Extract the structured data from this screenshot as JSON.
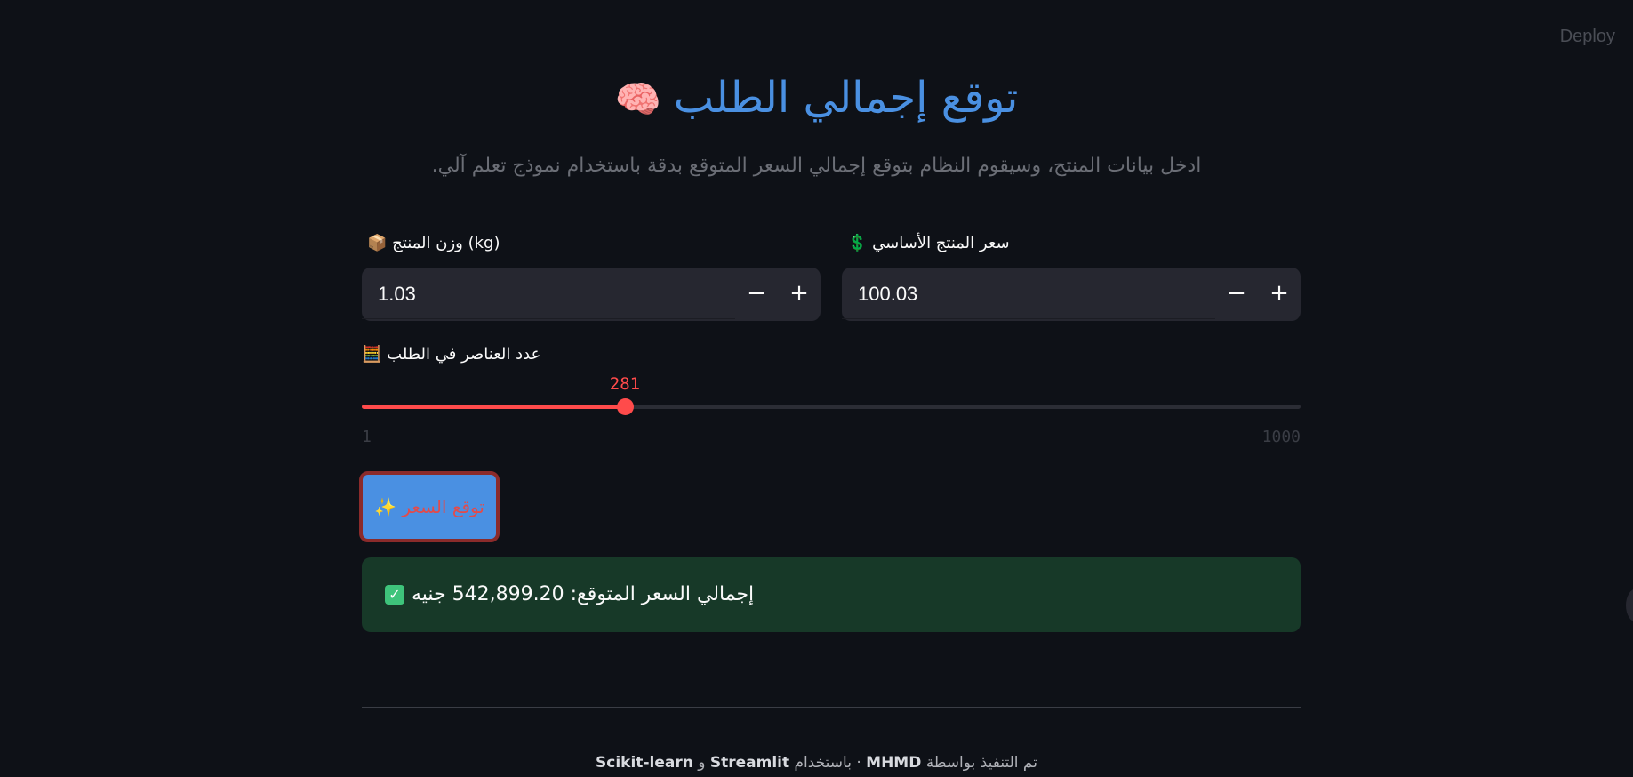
{
  "header": {
    "deploy_label": "Deploy"
  },
  "title": {
    "text": "توقع إجمالي الطلب",
    "emoji": "🧠"
  },
  "subtitle": ".ادخل بيانات المنتج، وسيقوم النظام بتوقع إجمالي السعر المتوقع بدقة باستخدام نموذج تعلم آلي",
  "fields": {
    "weight": {
      "label": "وزن المنتج (kg)",
      "emoji": "📦",
      "value": "1.03"
    },
    "price": {
      "label": "سعر المنتج الأساسي",
      "emoji": "💲",
      "value": "100.03"
    }
  },
  "slider": {
    "label": "عدد العناصر في الطلب",
    "emoji": "🧮",
    "value": 281,
    "min": 1,
    "max": 1000,
    "min_label": "1",
    "max_label": "1000",
    "value_label": "281"
  },
  "predict_button": {
    "label": "توقع السعر",
    "emoji": "✨"
  },
  "result": {
    "text": "إجمالي السعر المتوقع: 542,899.20 جنيه",
    "icon": "check-icon"
  },
  "footer": {
    "prefix": "تم التنفيذ بواسطة",
    "author": "MHMD",
    "middle": "باستخدام",
    "tool1": "Streamlit",
    "and": "و",
    "tool2": "Scikit-learn",
    "sep": "·"
  },
  "colors": {
    "background": "#0e1117",
    "accent": "#ff4b4b",
    "title": "#4a90e2",
    "success_bg": "#173928"
  }
}
